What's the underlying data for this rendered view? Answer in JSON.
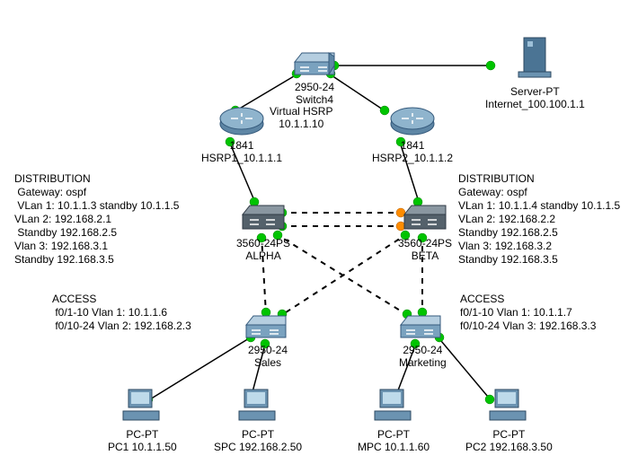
{
  "nodes": {
    "switch4": {
      "model": "2950-24",
      "name": "Switch4"
    },
    "vhsrp": {
      "title": "Virtual HSRP",
      "ip": "10.1.1.10"
    },
    "server": {
      "model": "Server-PT",
      "name": "Internet_100.100.1.1"
    },
    "hsrp1": {
      "model": "1841",
      "name": "HSRP1_10.1.1.1"
    },
    "hsrp2": {
      "model": "1841",
      "name": "HSRP2_10.1.1.2"
    },
    "alpha": {
      "model": "3560-24PS",
      "name": "ALPHA"
    },
    "beta": {
      "model": "3560-24PS",
      "name": "BETA"
    },
    "sales": {
      "model": "2950-24",
      "name": "Sales"
    },
    "marketing": {
      "model": "2950-24",
      "name": "Marketing"
    },
    "pc1": {
      "model": "PC-PT",
      "name": "PC1 10.1.1.50"
    },
    "spc": {
      "model": "PC-PT",
      "name": "SPC 192.168.2.50"
    },
    "mpc": {
      "model": "PC-PT",
      "name": "MPC 10.1.1.60"
    },
    "pc2": {
      "model": "PC-PT",
      "name": "PC2 192.168.3.50"
    }
  },
  "textblocks": {
    "dist_left": "DISTRIBUTION\n Gateway: ospf\n VLan 1: 10.1.1.3 standby 10.1.1.5\nVLan 2: 192.168.2.1\n Standby 192.168.2.5\nVlan 3: 192.168.3.1\nStandby 192.168.3.5",
    "dist_right": "DISTRIBUTION\nGateway: ospf\nVLan 1: 10.1.1.4 standby 10.1.1.5\nVLan 2: 192.168.2.2\nStandby 192.168.2.5\nVlan 3: 192.168.3.2\nStandby 192.168.3.5",
    "acc_left": "ACCESS\n f0/1-10 Vlan 1: 10.1.1.6\n f0/10-24 Vlan 2: 192.168.2.3",
    "acc_right": "ACCESS\nf0/1-10 Vlan 1: 10.1.1.7\nf0/10-24 Vlan 3: 192.168.3.3"
  }
}
